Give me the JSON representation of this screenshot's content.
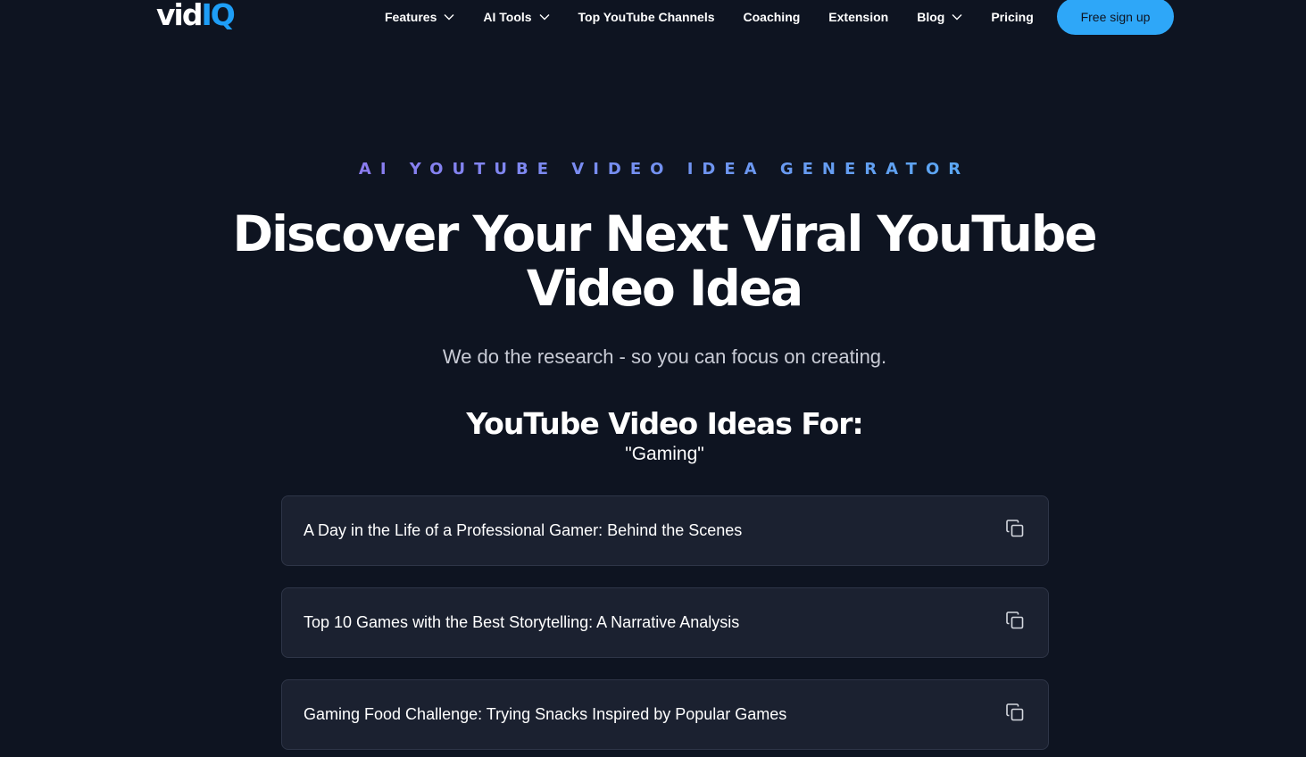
{
  "brand": {
    "logo_part1": "vid",
    "logo_part2": "IQ",
    "accent": "#1e9ef7"
  },
  "nav": {
    "items": [
      {
        "label": "Features",
        "has_dropdown": true
      },
      {
        "label": "AI Tools",
        "has_dropdown": true
      },
      {
        "label": "Top YouTube Channels",
        "has_dropdown": false
      },
      {
        "label": "Coaching",
        "has_dropdown": false
      },
      {
        "label": "Extension",
        "has_dropdown": false
      },
      {
        "label": "Blog",
        "has_dropdown": true
      },
      {
        "label": "Pricing",
        "has_dropdown": false
      }
    ],
    "signup_label": "Free sign up",
    "signup_color": "#2ea7f8"
  },
  "hero": {
    "eyebrow": "AI YOUTUBE VIDEO IDEA GENERATOR",
    "headline": "Discover Your Next Viral YouTube Video Idea",
    "subhead": "We do the research - so you can focus on creating."
  },
  "ideas": {
    "title": "YouTube Video Ideas For:",
    "query": "\"Gaming\"",
    "items": [
      {
        "text": "A Day in the Life of a Professional Gamer: Behind the Scenes",
        "icon": "copy-icon"
      },
      {
        "text": "Top 10 Games with the Best Storytelling: A Narrative Analysis",
        "icon": "copy-icon"
      },
      {
        "text": "Gaming Food Challenge: Trying Snacks Inspired by Popular Games",
        "icon": "copy-icon"
      }
    ]
  }
}
